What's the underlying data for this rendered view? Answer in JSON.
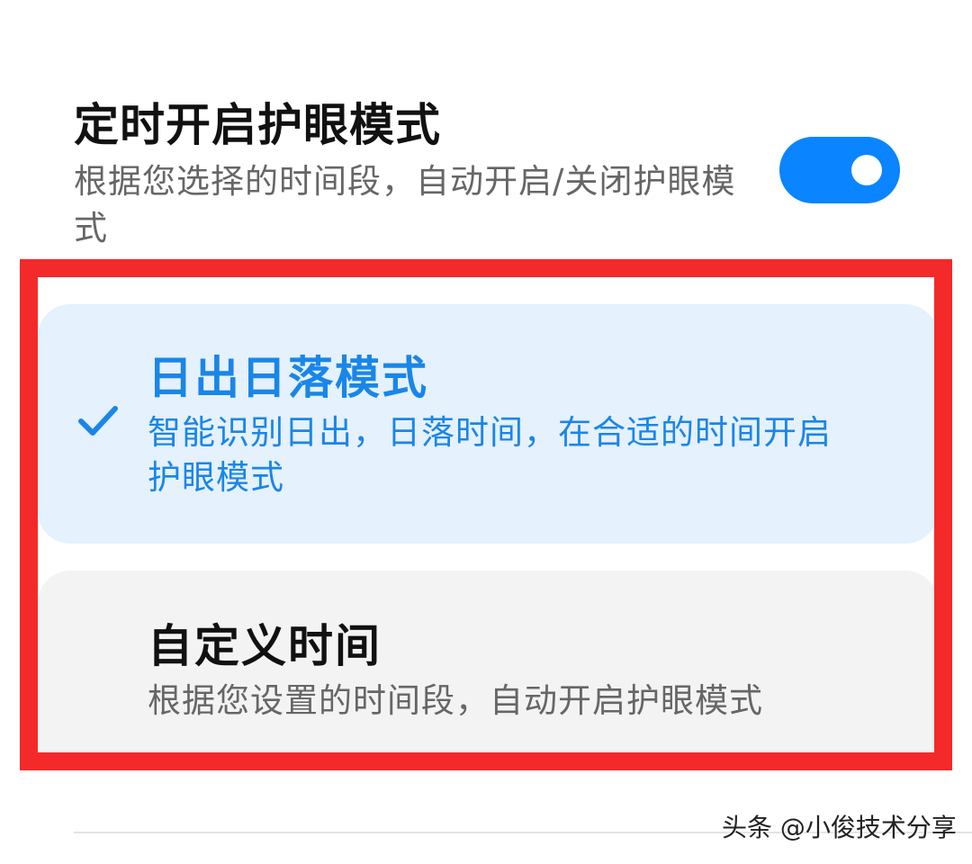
{
  "setting": {
    "title": "定时开启护眼模式",
    "description": "根据您选择的时间段，自动开启/关闭护眼模式",
    "toggle_on": true,
    "accent_color": "#0a84ff"
  },
  "options": [
    {
      "title": "日出日落模式",
      "description": "智能识别日出，日落时间，在合适的时间开启护眼模式",
      "selected": true,
      "icon": "checkmark-icon"
    },
    {
      "title": "自定义时间",
      "description": "根据您设置的时间段，自动开启护眼模式",
      "selected": false
    }
  ],
  "highlight_color": "#f42a2a",
  "watermark": "头条 @小俊技术分享"
}
